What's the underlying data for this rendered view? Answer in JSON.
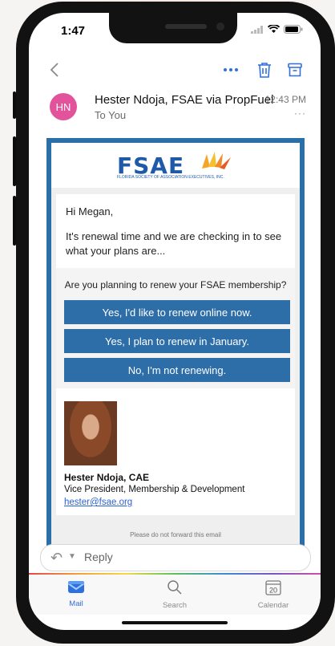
{
  "status": {
    "time": "1:47"
  },
  "toolbar": {
    "back_icon": "chevron-left-icon",
    "more_icon": "more-horizontal-icon",
    "delete_icon": "trash-icon",
    "archive_icon": "archive-icon"
  },
  "message": {
    "avatar_initials": "HN",
    "sender": "Hester Ndoja, FSAE via PropFuel",
    "to": "To You",
    "time": "12:43 PM",
    "more": "···"
  },
  "email": {
    "logo_text": "FSAE",
    "logo_subtitle": "FLORIDA SOCIETY OF ASSOCIATION EXECUTIVES, INC.",
    "greeting": "Hi Megan,",
    "intro": "It's renewal time and we are checking in to see what your plans are...",
    "question": "Are you planning to renew your FSAE membership?",
    "buttons": [
      "Yes, I'd like to renew online now.",
      "Yes, I plan to renew in January.",
      "No, I'm not renewing."
    ],
    "signature": {
      "name": "Hester Ndoja, CAE",
      "title": "Vice President, Membership & Development",
      "email": "hester@fsae.org"
    },
    "footer": "Please do not forward this email"
  },
  "reply": {
    "label": "Reply"
  },
  "tabs": [
    {
      "label": "Mail",
      "icon": "mail-icon",
      "active": true
    },
    {
      "label": "Search",
      "icon": "search-icon",
      "active": false
    },
    {
      "label": "Calendar",
      "icon": "calendar-icon",
      "active": false,
      "day": "20"
    }
  ],
  "colors": {
    "accent": "#2f6fde",
    "button": "#2d6da8",
    "avatar": "#e2539c"
  }
}
